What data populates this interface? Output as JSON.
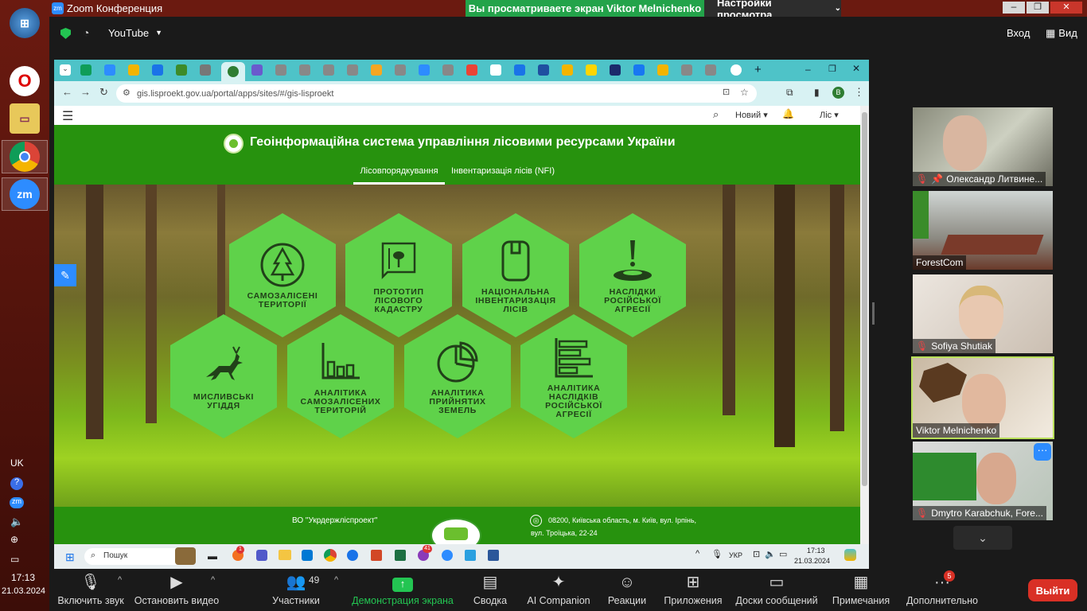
{
  "zoom": {
    "title": "Zoom Конференция",
    "share_badge": "Вы просматриваете экран Viktor Melnichenko",
    "view_options": "Настройки просмотра",
    "source": "YouTube",
    "enter": "Вход",
    "view": "Вид"
  },
  "browser": {
    "url": "gis.lisproekt.gov.ua/portal/apps/sites/#/gis-lisproekt",
    "profile": "В"
  },
  "portal": {
    "menu_new": "Новий",
    "menu_user": "Ліс",
    "title": "Геоінформаційна система управління лісовими ресурсами України",
    "tabs": [
      "Лісовпорядкування",
      "Інвентаризація лісів (NFI)"
    ],
    "tiles": [
      "САМОЗАЛІСЕНІ ТЕРИТОРІЇ",
      "ПРОТОТИП ЛІСОВОГО КАДАСТРУ",
      "НАЦІОНАЛЬНА ІНВЕНТАРИЗАЦІЯ ЛІСІВ",
      "НАСЛІДКИ РОСІЙСЬКОЇ АГРЕСІЇ",
      "МИСЛИВСЬКІ УГІДДЯ",
      "АНАЛІТИКА САМОЗАЛІСЕНИХ ТЕРИТОРІЙ",
      "АНАЛІТИКА ПРИЙНЯТИХ ЗЕМЕЛЬ",
      "АНАЛІТИКА НАСЛІДКІВ РОСІЙСЬКОЇ АГРЕСІЇ"
    ],
    "footer_org": "ВО \"Укрдержліспроект\"",
    "footer_addr1": "08200, Київська область, м. Київ, вул. Ірпінь,",
    "footer_addr2": "вул. Троїцька, 22-24"
  },
  "win_taskbar": {
    "search": "Пошук",
    "lang": "УКР",
    "time": "17:13",
    "date": "21.03.2024",
    "badge1": "1",
    "badge2": "41"
  },
  "left_taskbar": {
    "lang": "UK",
    "time": "17:13",
    "date": "21.03.2024"
  },
  "participants": [
    {
      "name": "Олександр Литвине..."
    },
    {
      "name": "ForestCom"
    },
    {
      "name": "Sofiya Shutiak"
    },
    {
      "name": "Viktor Melnichenko"
    },
    {
      "name": "Dmytro Karabchuk, Fore..."
    }
  ],
  "toolbar": {
    "mute": "Включить звук",
    "video": "Остановить видео",
    "participants": "Участники",
    "participants_count": "49",
    "share": "Демонстрация экрана",
    "summary": "Сводка",
    "ai": "AI Companion",
    "reactions": "Реакции",
    "apps": "Приложения",
    "whiteboards": "Доски сообщений",
    "notes": "Примечания",
    "more": "Дополнительно",
    "more_badge": "5",
    "leave": "Выйти"
  },
  "colors": {
    "portal_green": "#27920e",
    "hex_green": "#5fd24a",
    "share_green": "#23a34a",
    "leave_red": "#d93025"
  }
}
